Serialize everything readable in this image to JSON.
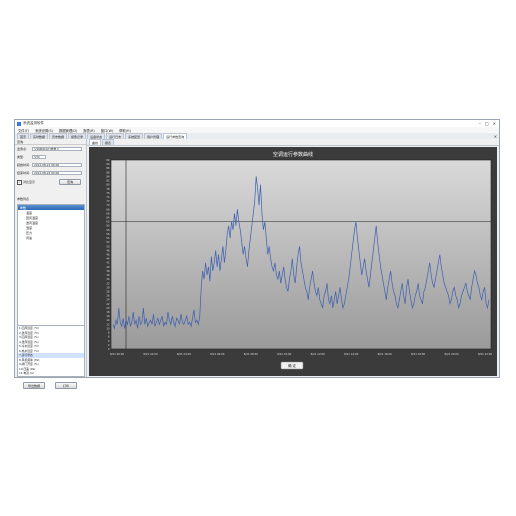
{
  "window": {
    "title": "系统监测软件",
    "controls": [
      "–",
      "□",
      "×"
    ]
  },
  "menu": [
    "文件(F)",
    "系统设置(S)",
    "数据管理(D)",
    "报表(R)",
    "窗口(W)",
    "帮助(H)"
  ],
  "tabs": [
    {
      "label": "首页"
    },
    {
      "label": "实时数据"
    },
    {
      "label": "历史数据"
    },
    {
      "label": "报警记录"
    },
    {
      "label": "设备状态"
    },
    {
      "label": "运行日志"
    },
    {
      "label": "系统配置"
    },
    {
      "label": "用户管理"
    },
    {
      "label": "运行参数查询",
      "active": true
    }
  ],
  "left_panel": {
    "header": "查询",
    "fields": [
      {
        "label": "监测点:",
        "value": "空调机组运行参数 ▾"
      },
      {
        "label": "类型:",
        "value": "全部"
      },
      {
        "label": "起始时间:",
        "value": "2012-08-21  06:00"
      },
      {
        "label": "结束时间:",
        "value": "2012-08-22  00:00"
      }
    ],
    "checkbox_label": "对比显示",
    "query_button": "查询",
    "tree_title": "参数列表",
    "tree": [
      {
        "label": "参数",
        "selected": true
      },
      {
        "label": "温度"
      },
      {
        "label": "回风温度"
      },
      {
        "label": "送风温度"
      },
      {
        "label": "湿度"
      },
      {
        "label": "压力"
      },
      {
        "label": "风速"
      }
    ],
    "list": [
      {
        "label": "1.回风温度 (℃)"
      },
      {
        "label": "2.送风温度 (℃)"
      },
      {
        "label": "3.回风湿度 (%)"
      },
      {
        "label": "4.送风湿度 (%)"
      },
      {
        "label": "5.冷水温度 (℃)"
      },
      {
        "label": "6.热水温度 (℃)"
      },
      {
        "label": "7.运行状态",
        "selected": true
      },
      {
        "label": "8.风机频率 (Hz)"
      },
      {
        "label": "9.阀门开度 (%)"
      },
      {
        "label": "10.压差 (Pa)"
      },
      {
        "label": "11.电流 (A)"
      }
    ],
    "buttons": {
      "export": "导出数据",
      "print": "打印"
    }
  },
  "right_panel": {
    "subtabs": [
      "曲线",
      "报表"
    ]
  },
  "chart_data": {
    "type": "line",
    "title": "空调运行参数曲线",
    "legend": "",
    "y_ticks": [
      0,
      2,
      4,
      6,
      8,
      10,
      12,
      14,
      16,
      18,
      20,
      22,
      24,
      26,
      28,
      30,
      32,
      34,
      36,
      38,
      40,
      42,
      44,
      46,
      48,
      50,
      52,
      54,
      56,
      58,
      60,
      62,
      64,
      66,
      68,
      70,
      72,
      74,
      76,
      78,
      80,
      82,
      84,
      86,
      88,
      90,
      92
    ],
    "ylim": [
      0,
      92
    ],
    "x_ticks": [
      "8/21 00:00",
      "8/21 02:00",
      "8/21 04:00",
      "8/21 06:00",
      "8/21 08:00",
      "8/21 10:00",
      "8/21 12:00",
      "8/21 14:00",
      "8/21 16:00",
      "8/21 18:00",
      "8/21 20:00",
      "8/21 22:00"
    ],
    "reference_line": 62,
    "colors": {
      "line": "#3d5fb0",
      "ref": "#222222",
      "plot_top": "#d9d9d9",
      "plot_bottom": "#9a9a9a",
      "panel": "#3b3b3b"
    },
    "series": [
      {
        "values": [
          12,
          10,
          14,
          12,
          20,
          13,
          11,
          15,
          10,
          14,
          12,
          16,
          11,
          13,
          18,
          12,
          14,
          10,
          16,
          12,
          13,
          20,
          12,
          15,
          11,
          13,
          14,
          12,
          17,
          11,
          13,
          15,
          12,
          14,
          16,
          11,
          13,
          12,
          18,
          14,
          12,
          16,
          13,
          11,
          15,
          14,
          12,
          17,
          13,
          12,
          14,
          16,
          12,
          13,
          11,
          15,
          19,
          13,
          14,
          12,
          16,
          30,
          38,
          34,
          42,
          36,
          40,
          33,
          45,
          38,
          42,
          48,
          40,
          46,
          38,
          44,
          50,
          42,
          48,
          56,
          60,
          54,
          62,
          58,
          66,
          60,
          68,
          62,
          58,
          52,
          46,
          50,
          44,
          40,
          48,
          54,
          60,
          66,
          72,
          84,
          78,
          70,
          80,
          66,
          58,
          62,
          54,
          46,
          50,
          44,
          40,
          38,
          42,
          36,
          34,
          38,
          32,
          36,
          40,
          34,
          30,
          28,
          34,
          38,
          44,
          36,
          32,
          40,
          46,
          50,
          42,
          38,
          34,
          30,
          28,
          24,
          30,
          34,
          38,
          32,
          28,
          26,
          30,
          24,
          22,
          20,
          26,
          28,
          32,
          24,
          22,
          26,
          20,
          24,
          28,
          22,
          26,
          30,
          24,
          20,
          22,
          26,
          30,
          34,
          40,
          46,
          52,
          58,
          62,
          54,
          48,
          42,
          36,
          40,
          44,
          38,
          34,
          30,
          36,
          42,
          48,
          54,
          60,
          52,
          46,
          40,
          36,
          32,
          28,
          24,
          30,
          34,
          38,
          32,
          28,
          26,
          22,
          20,
          24,
          28,
          32,
          26,
          22,
          30,
          34,
          28,
          24,
          20,
          22,
          26,
          28,
          32,
          26,
          24,
          22,
          28,
          30,
          34,
          38,
          42,
          36,
          32,
          30,
          34,
          38,
          42,
          46,
          40,
          36,
          32,
          30,
          28,
          26,
          22,
          24,
          28,
          30,
          26,
          24,
          20,
          22,
          26,
          28,
          30,
          32,
          28,
          26,
          24,
          30,
          34,
          38,
          36,
          32,
          30,
          26,
          24,
          28,
          30,
          22,
          20,
          24
        ]
      }
    ]
  },
  "chart_footer_button": "确 定"
}
